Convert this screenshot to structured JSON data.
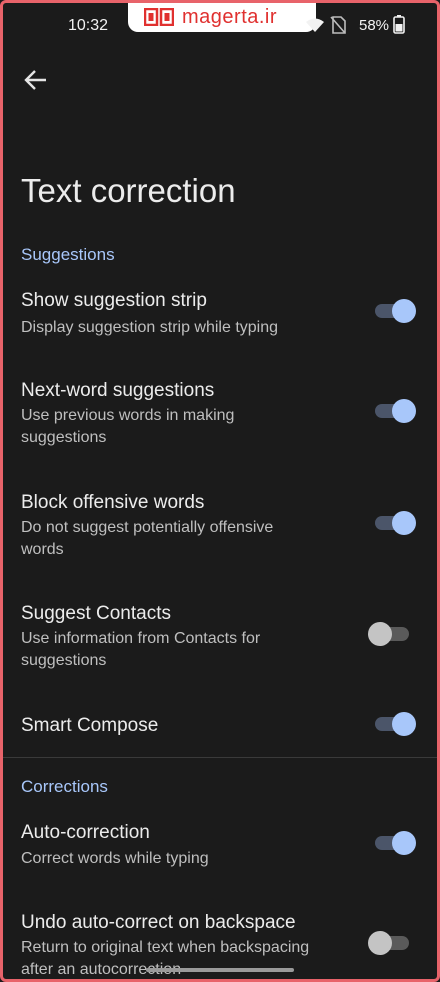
{
  "status_bar": {
    "time": "10:32",
    "battery_percent": "58%",
    "watermark": "magerta.ir",
    "watermark_color": "#e0302f"
  },
  "header": {
    "back_icon": "arrow-left-icon",
    "title": "Text correction"
  },
  "sections": {
    "suggestions_label": "Suggestions",
    "corrections_label": "Corrections"
  },
  "settings": {
    "show_strip": {
      "title": "Show suggestion strip",
      "subtitle": "Display suggestion strip while typing",
      "enabled": true
    },
    "next_word": {
      "title": "Next-word suggestions",
      "subtitle": "Use previous words in making suggestions",
      "enabled": true
    },
    "block_offensive": {
      "title": "Block offensive words",
      "subtitle": "Do not suggest potentially offensive words",
      "enabled": true
    },
    "suggest_contacts": {
      "title": "Suggest Contacts",
      "subtitle": "Use information from Contacts for suggestions",
      "enabled": false
    },
    "smart_compose": {
      "title": "Smart Compose",
      "enabled": true
    },
    "auto_correction": {
      "title": "Auto-correction",
      "subtitle": "Correct words while typing",
      "enabled": true
    },
    "undo_autocorrect": {
      "title": "Undo auto-correct on backspace",
      "subtitle": "Return to original text when backspacing after an autocorrection",
      "enabled": false
    }
  },
  "colors": {
    "accent": "#a8c7fa",
    "background": "#1b1b1b",
    "frame": "#e8636a"
  }
}
